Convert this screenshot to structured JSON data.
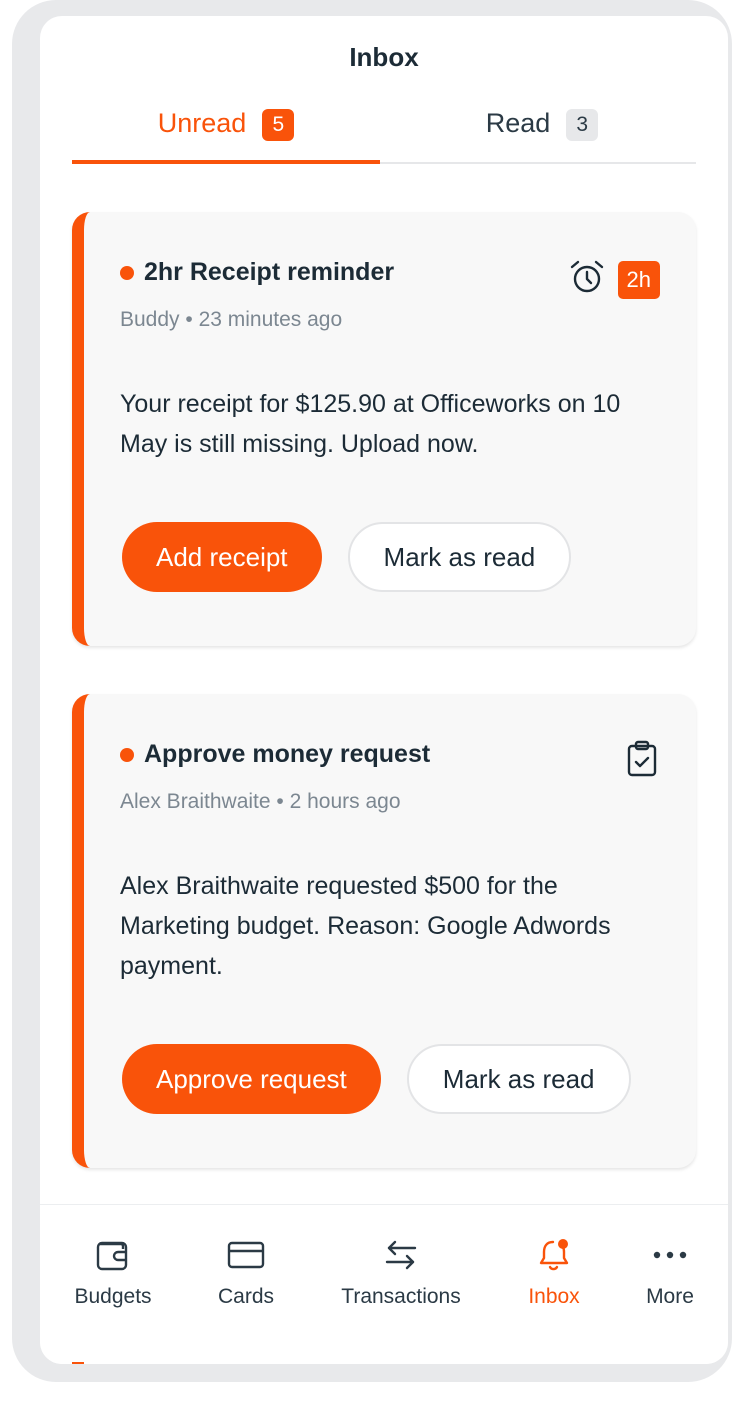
{
  "header": {
    "title": "Inbox"
  },
  "tabs": [
    {
      "label": "Unread",
      "count": "5",
      "active": true
    },
    {
      "label": "Read",
      "count": "3",
      "active": false
    }
  ],
  "notifications": [
    {
      "title": "2hr Receipt reminder",
      "meta": "Buddy • 23 minutes ago",
      "body": "Your receipt for $125.90 at Officeworks on 10 May is still missing. Upload now.",
      "icon": "alarm-clock-icon",
      "time_badge": "2h",
      "primary_action": "Add receipt",
      "secondary_action": "Mark as read"
    },
    {
      "title": "Approve money request",
      "meta": "Alex Braithwaite • 2 hours ago",
      "body": "Alex Braithwaite requested $500 for the Marketing budget. Reason: Google Adwords payment.",
      "icon": "clipboard-check-icon",
      "primary_action": "Approve request",
      "secondary_action": "Mark as read"
    }
  ],
  "bottom_nav": [
    {
      "label": "Budgets",
      "icon": "wallet-icon",
      "active": false
    },
    {
      "label": "Cards",
      "icon": "card-icon",
      "active": false
    },
    {
      "label": "Transactions",
      "icon": "transfer-arrows-icon",
      "active": false
    },
    {
      "label": "Inbox",
      "icon": "bell-icon",
      "active": true
    },
    {
      "label": "More",
      "icon": "more-dots-icon",
      "active": false
    }
  ],
  "colors": {
    "accent": "#f9530a",
    "text": "#1c2b36",
    "muted": "#7c8791",
    "card_bg": "#f8f8f8"
  }
}
